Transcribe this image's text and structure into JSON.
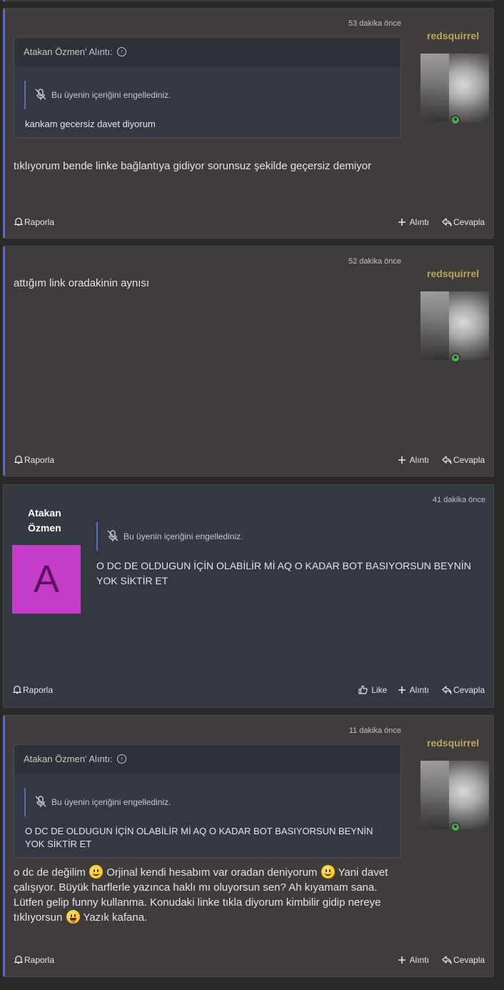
{
  "posts": [
    {
      "time": "53 dakika önce",
      "author": "redsquirrel",
      "quote": {
        "header": "Atakan Özmen' Alıntı:",
        "blocked": "Bu üyenin içeriğini engellediniz.",
        "text": "kankam gecersiz davet diyorum"
      },
      "body": "tıklıyorum bende linke bağlantıya gidiyor sorunsuz şekilde geçersiz demiyor",
      "actions": {
        "report": "Raporla",
        "quote": "Alıntı",
        "reply": "Cevapla"
      }
    },
    {
      "time": "52 dakika önce",
      "author": "redsquirrel",
      "body": "attığım link oradakinin aynısı",
      "actions": {
        "report": "Raporla",
        "quote": "Alıntı",
        "reply": "Cevapla"
      }
    },
    {
      "time": "41 dakika önce",
      "author_line1": "Atakan",
      "author_line2": "Özmen",
      "avatar_letter": "A",
      "blocked": "Bu üyenin içeriğini engellediniz.",
      "body": "O DC DE OLDUGUN İÇİN OLABİLİR Mİ AQ O KADAR BOT BASIYORSUN BEYNİN YOK SİKTİR ET",
      "actions": {
        "report": "Raporla",
        "like": "Like",
        "quote": "Alıntı",
        "reply": "Cevapla"
      }
    },
    {
      "time": "11 dakika önce",
      "author": "redsquirrel",
      "quote": {
        "header": "Atakan Özmen' Alıntı:",
        "blocked": "Bu üyenin içeriğini engellediniz.",
        "text": "O DC DE OLDUGUN İÇİN OLABİLİR Mİ AQ O KADAR BOT BASIYORSUN BEYNİN YOK SİKTİR ET"
      },
      "body_parts": [
        "o dc de değilim",
        " Orjinal kendi hesabım var oradan deniyorum",
        " Yani davet çalışıyor. Büyük harflerle yazınca haklı mı oluyorsun sen? Ah kıyamam sana. Lütfen gelip funny kullanma. Konudaki linke tıkla diyorum kimbilir gidip nereye tıklıyorsun",
        " Yazık kafana."
      ],
      "actions": {
        "report": "Raporla",
        "quote": "Alıntı",
        "reply": "Cevapla"
      }
    }
  ],
  "colors": {
    "self_accent": "#5c6bc0",
    "username": "#b7a75a",
    "online": "#4caf50",
    "letter_avatar": "#c53cc9"
  },
  "icons": [
    "bell-icon",
    "plus-icon",
    "reply-icon",
    "thumbs-up-icon",
    "arrow-up-circle-icon",
    "microphone-off-icon",
    "smile-emoji",
    "tongue-emoji"
  ]
}
